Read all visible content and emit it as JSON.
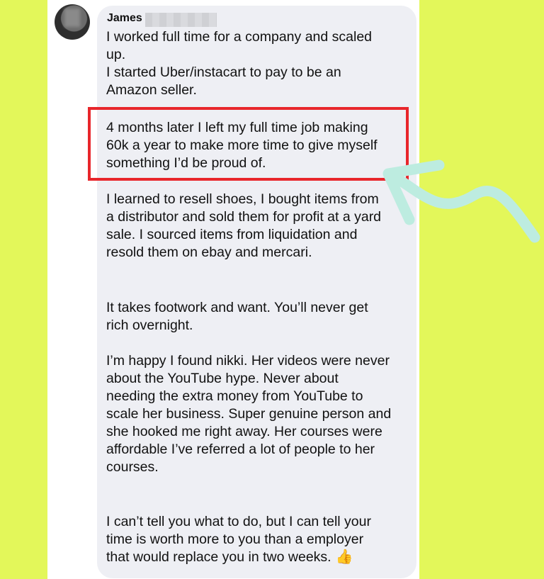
{
  "comment": {
    "author_name": "James",
    "paragraphs": {
      "p1": [
        "I worked full time for a company and scaled",
        "up.",
        "I started Uber/instacart to pay to be an",
        "Amazon seller."
      ],
      "p2": [
        "4 months later I left my full time job making",
        "60k a year to make more time to give myself",
        "something I’d be proud of."
      ],
      "p3": [
        "I learned to resell shoes, I bought items from",
        "a distributor and sold them for profit at a yard",
        "sale. I sourced items from liquidation and",
        "resold them on ebay and mercari."
      ],
      "p4": [
        "It takes footwork and want. You’ll never get",
        "rich overnight."
      ],
      "p5": [
        "I’m happy I found nikki. Her videos were never",
        "about the YouTube hype. Never about",
        "needing the extra money from YouTube to",
        "scale her business. Super genuine person and",
        "she hooked me right away. Her courses were",
        "affordable I’ve referred a lot of people to her",
        "courses."
      ],
      "p6": [
        "I can’t tell you what to do, but I can tell your",
        "time is worth more to you than a employer",
        "that would replace you in two weeks."
      ]
    },
    "emoji": "👍"
  },
  "colors": {
    "background": "#e3f75a",
    "bubble": "#eeeff4",
    "highlight_box": "#e8262b",
    "arrow": "#bdece0"
  },
  "icons": {
    "avatar": "avatar-photo-blurred",
    "annotation": "curved-arrow-icon"
  }
}
